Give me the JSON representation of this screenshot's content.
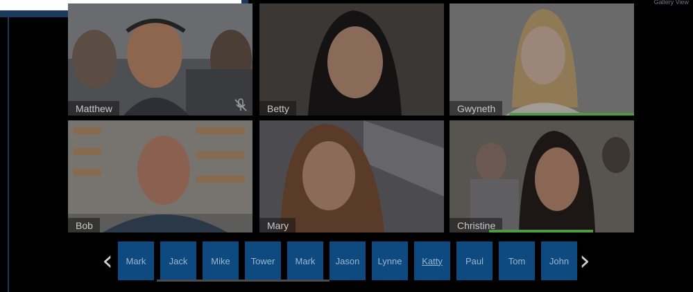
{
  "view_label": "Gallery View",
  "participants": [
    {
      "name": "Matthew",
      "muted": true,
      "speaking": false
    },
    {
      "name": "Betty",
      "muted": false,
      "speaking": false
    },
    {
      "name": "Gwyneth",
      "muted": false,
      "speaking": true
    },
    {
      "name": "Bob",
      "muted": false,
      "speaking": false
    },
    {
      "name": "Mary",
      "muted": false,
      "speaking": false
    },
    {
      "name": "Christine",
      "muted": false,
      "speaking": true
    }
  ],
  "thumbnails": [
    "Mark",
    "Jack",
    "Mike",
    "Tower",
    "Mark",
    "Jason",
    "Lynne",
    "Katty",
    "Paul",
    "Tom",
    "John"
  ],
  "active_thumbnail": "Katty",
  "colors": {
    "accent": "#0e4a80",
    "speaking": "#4f9b43",
    "frame": "#1b3a5c"
  }
}
